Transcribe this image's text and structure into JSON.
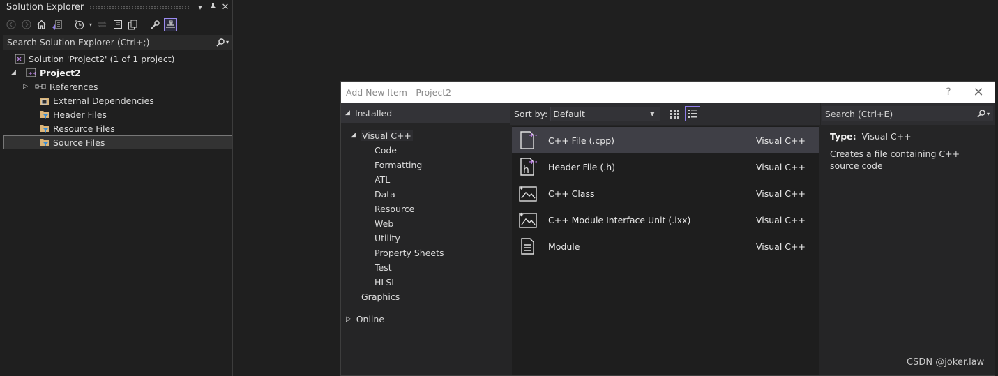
{
  "solution_explorer": {
    "title": "Solution Explorer",
    "title_buttons": [
      "▾",
      "pin",
      "✕"
    ],
    "search_placeholder": "Search Solution Explorer (Ctrl+;)",
    "tree": {
      "solution": "Solution 'Project2' (1 of 1 project)",
      "project": "Project2",
      "children": [
        "References",
        "External Dependencies",
        "Header Files",
        "Resource Files",
        "Source Files"
      ]
    }
  },
  "dialog": {
    "title": "Add New Item - Project2",
    "help": "?",
    "close": "✕",
    "installed": "Installed",
    "visual_cpp": "Visual C++",
    "categories": [
      "Code",
      "Formatting",
      "ATL",
      "Data",
      "Resource",
      "Web",
      "Utility",
      "Property Sheets",
      "Test",
      "HLSL"
    ],
    "graphics": "Graphics",
    "online": "Online",
    "sort_label": "Sort by:",
    "sort_value": "Default",
    "search_placeholder": "Search (Ctrl+E)",
    "items": [
      {
        "name": "C++ File (.cpp)",
        "lang": "Visual C++",
        "icon": "cpp-file-icon"
      },
      {
        "name": "Header File (.h)",
        "lang": "Visual C++",
        "icon": "header-file-icon"
      },
      {
        "name": "C++ Class",
        "lang": "Visual C++",
        "icon": "class-icon"
      },
      {
        "name": "C++ Module Interface Unit (.ixx)",
        "lang": "Visual C++",
        "icon": "module-interface-icon"
      },
      {
        "name": "Module",
        "lang": "Visual C++",
        "icon": "module-icon"
      }
    ],
    "info": {
      "type_label": "Type:",
      "type_value": "Visual C++",
      "description": "Creates a file containing C++ source code"
    }
  },
  "watermark": "CSDN @joker.law",
  "colors": {
    "background": "#1f1f1f",
    "accent": "#9b8bf0",
    "selected_row": "#3f3f46",
    "folder": "#dcb67a"
  }
}
